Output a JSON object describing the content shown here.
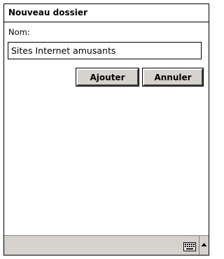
{
  "dialog": {
    "title": "Nouveau dossier"
  },
  "form": {
    "name_label": "Nom:",
    "name_value": "Sites Internet amusants"
  },
  "buttons": {
    "add_label": "Ajouter",
    "cancel_label": "Annuler"
  },
  "bottom_bar": {
    "input_panel_icon": "keyboard-icon",
    "input_panel_arrow_icon": "arrow-up-icon"
  },
  "colors": {
    "button_face": "#d6d3ce",
    "bar_background": "#d6d3ce",
    "border": "#000000"
  }
}
